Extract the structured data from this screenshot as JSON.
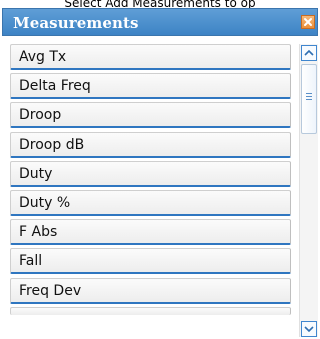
{
  "top_text": "Select Add Measurements to op",
  "panel": {
    "title": "Measurements",
    "close_icon": "close-icon",
    "items": [
      {
        "label": "Avg Tx"
      },
      {
        "label": "Delta Freq"
      },
      {
        "label": "Droop"
      },
      {
        "label": "Droop dB"
      },
      {
        "label": "Duty"
      },
      {
        "label": "Duty %"
      },
      {
        "label": "F Abs"
      },
      {
        "label": "Fall"
      },
      {
        "label": "Freq Dev"
      },
      {
        "label": ""
      }
    ]
  },
  "scrollbar": {
    "up_icon": "chevron-up-icon",
    "down_icon": "chevron-down-icon",
    "thumb_grip_icon": "grip-icon"
  },
  "colors": {
    "titlebar": "#4a8fcf",
    "item_underline": "#2f76c0",
    "close_button": "#ea8f3a"
  }
}
